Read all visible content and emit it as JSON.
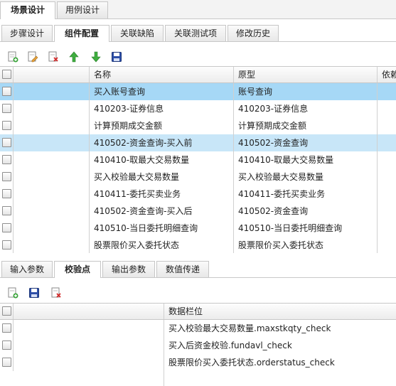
{
  "top_tabs": [
    "场景设计",
    "用例设计"
  ],
  "sub_tabs": [
    "步骤设计",
    "组件配置",
    "关联缺陷",
    "关联测试项",
    "修改历史"
  ],
  "component_grid": {
    "columns": [
      "名称",
      "原型",
      "依赖"
    ],
    "rows": [
      {
        "name": "买入账号查询",
        "proto": "账号查询"
      },
      {
        "name": "410203-证券信息",
        "proto": "410203-证券信息"
      },
      {
        "name": "计算预期成交金额",
        "proto": "计算预期成交金额"
      },
      {
        "name": "410502-资金查询-买入前",
        "proto": "410502-资金查询"
      },
      {
        "name": "410410-取最大交易数量",
        "proto": "410410-取最大交易数量"
      },
      {
        "name": "买入校验最大交易数量",
        "proto": "买入校验最大交易数量"
      },
      {
        "name": "410411-委托买卖业务",
        "proto": "410411-委托买卖业务"
      },
      {
        "name": "410502-资金查询-买入后",
        "proto": "410502-资金查询"
      },
      {
        "name": "410510-当日委托明细查询",
        "proto": "410510-当日委托明细查询"
      },
      {
        "name": "股票限价买入委托状态",
        "proto": "股票限价买入委托状态"
      }
    ]
  },
  "bottom_tabs": [
    "输入参数",
    "校验点",
    "输出参数",
    "数值传递"
  ],
  "check_grid": {
    "column": "数据栏位",
    "rows": [
      "买入校验最大交易数量.maxstkqty_check",
      "买入后资金校验.fundavl_check",
      "股票限价买入委托状态.orderstatus_check"
    ]
  },
  "colors": {
    "selected_row": "#a6d8f6",
    "highlight_row": "#c8e6f8"
  },
  "icons": {
    "top_toolbar": [
      "add-icon",
      "edit-icon",
      "delete-icon",
      "move-up-icon",
      "move-down-icon",
      "save-icon"
    ],
    "bottom_toolbar": [
      "add-icon",
      "save-icon",
      "delete-icon"
    ]
  }
}
